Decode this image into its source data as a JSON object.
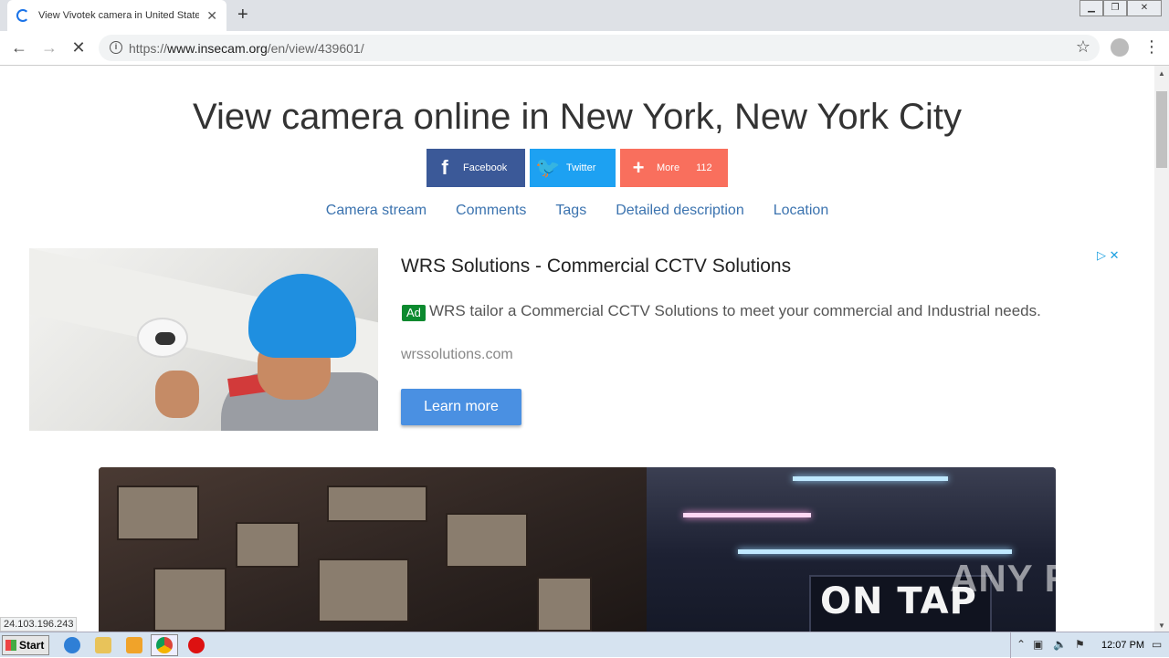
{
  "browser": {
    "tab_title": "View Vivotek camera in United States",
    "new_tab_label": "+",
    "url_scheme": "https://",
    "url_host": "www.insecam.org",
    "url_path": "/en/view/439601/"
  },
  "page": {
    "title": "View camera online in New York, New York City",
    "share": {
      "facebook_label": "Facebook",
      "twitter_label": "Twitter",
      "more_label": "More",
      "more_count": "112"
    },
    "nav_links": [
      "Camera stream",
      "Comments",
      "Tags",
      "Detailed description",
      "Location"
    ]
  },
  "ad": {
    "title": "WRS Solutions - Commercial CCTV Solutions",
    "badge": "Ad",
    "description": "WRS tailor a Commercial CCTV Solutions to meet your commercial and Industrial needs.",
    "domain": "wrssolutions.com",
    "cta": "Learn more"
  },
  "stream": {
    "sign_text": "ON TAP",
    "watermark": "ANY RUN"
  },
  "status_bar": {
    "ip": "24.103.196.243"
  },
  "taskbar": {
    "start_label": "Start",
    "clock": "12:07 PM"
  },
  "colors": {
    "facebook": "#3b5998",
    "twitter": "#1da1f2",
    "more": "#f96f5d",
    "link": "#3b73af",
    "ad_badge": "#0c8a2f",
    "cta": "#4a90e2"
  }
}
